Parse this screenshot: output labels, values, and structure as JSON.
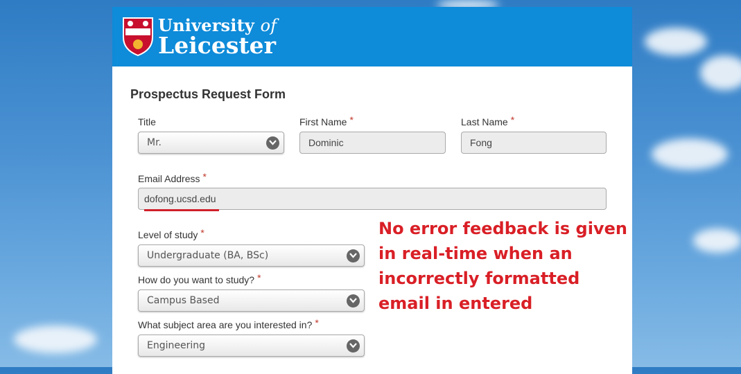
{
  "header": {
    "logo_line1": "University",
    "logo_of": "of",
    "logo_line2": "Leicester"
  },
  "form": {
    "title": "Prospectus Request Form",
    "required_marker": "*",
    "title_field": {
      "label": "Title",
      "value": "Mr."
    },
    "first_name": {
      "label": "First Name",
      "value": "Dominic"
    },
    "last_name": {
      "label": "Last Name",
      "value": "Fong"
    },
    "email": {
      "label": "Email Address",
      "value": "dofong.ucsd.edu"
    },
    "level_of_study": {
      "label": "Level of study",
      "value": "Undergraduate (BA, BSc)"
    },
    "study_mode": {
      "label": "How do you want to study?",
      "value": "Campus Based"
    },
    "subject_area": {
      "label": "What subject area are you interested in?",
      "value": "Engineering"
    }
  },
  "annotation": {
    "text": "No error feedback is given in real-time when an incorrectly formatted email in entered",
    "color": "#d91f26"
  },
  "colors": {
    "header_blue": "#0e8bd9",
    "error_red": "#d0202a"
  }
}
